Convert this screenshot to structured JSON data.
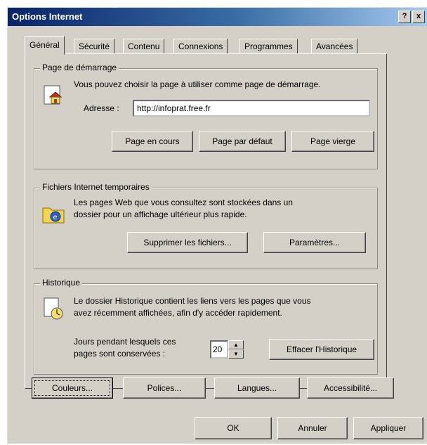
{
  "window": {
    "title": "Options Internet",
    "help_button": "?",
    "close_button": "x"
  },
  "tabs": [
    "Général",
    "Sécurité",
    "Contenu",
    "Connexions",
    "Programmes",
    "Avancées"
  ],
  "startup": {
    "group_title": "Page de démarrage",
    "description": "Vous pouvez choisir la page à utiliser comme page de démarrage.",
    "address_label": "Adresse :",
    "address_value": "http://infoprat.free.fr",
    "current_button": "Page en cours",
    "default_button": "Page par défaut",
    "blank_button": "Page vierge"
  },
  "temp_files": {
    "group_title": "Fichiers Internet temporaires",
    "description_line1": "Les pages Web que vous consultez sont stockées dans un",
    "description_line2": "dossier pour un affichage ultérieur plus rapide.",
    "delete_button": "Supprimer les fichiers...",
    "settings_button": "Paramètres..."
  },
  "history": {
    "group_title": "Historique",
    "description_line1": "Le dossier Historique contient les liens vers les pages que vous",
    "description_line2": "avez récemment affichées, afin d'y accéder rapidement.",
    "days_label_line1": "Jours pendant lesquels ces",
    "days_label_line2": "pages sont conservées :",
    "days_value": "20",
    "clear_button": "Effacer l'Historique"
  },
  "bottom_buttons": {
    "colors": "Couleurs...",
    "fonts": "Polices...",
    "languages": "Langues...",
    "accessibility": "Accessibilité..."
  },
  "dialog_buttons": {
    "ok": "OK",
    "cancel": "Annuler",
    "apply": "Appliquer"
  }
}
